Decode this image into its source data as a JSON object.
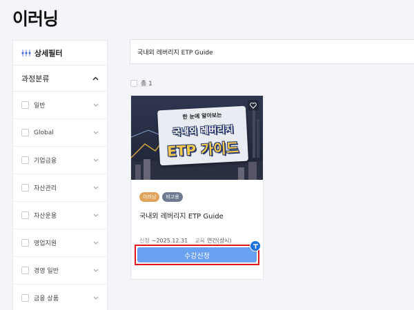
{
  "page": {
    "title": "이러닝"
  },
  "sidebar": {
    "filter_label": "상세필터",
    "category_label": "과정분류",
    "items": [
      {
        "label": "일반"
      },
      {
        "label": "Global"
      },
      {
        "label": "기업금융"
      },
      {
        "label": "자산관리"
      },
      {
        "label": "자산운용"
      },
      {
        "label": "영업지원"
      },
      {
        "label": "경영 일반"
      },
      {
        "label": "금융 상품"
      }
    ]
  },
  "search": {
    "value": "국내외 레버리지 ETP Guide"
  },
  "results": {
    "total_label": "총 1"
  },
  "card": {
    "thumb_sub": "한 눈에 알아보는",
    "thumb_line1": "국내외 레버리지",
    "thumb_line2": "ETP 가이드",
    "tags": [
      "이러닝",
      "비고용"
    ],
    "title": "국내외 레버리지 ETP Guide",
    "apply_label": "신청",
    "apply_value": "~2025.12.31",
    "edu_label": "교육",
    "edu_value": "연간(상시)",
    "button_label": "수강신청"
  },
  "colors": {
    "accent": "#6aa0f0",
    "highlight": "#e0141b",
    "tag_learn": "#e0a45b",
    "tag_free": "#6d7a92"
  }
}
